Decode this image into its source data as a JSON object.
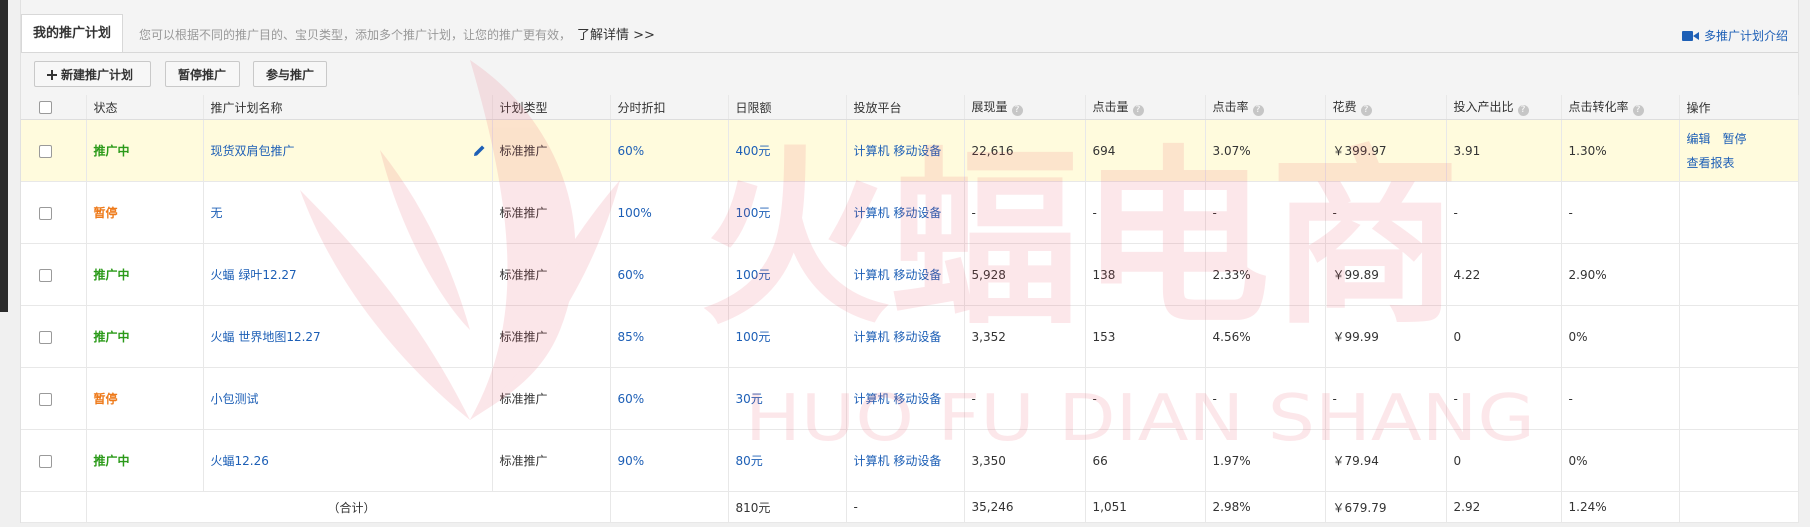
{
  "tab": {
    "label": "我的推广计划"
  },
  "tip": {
    "text": "您可以根据不同的推广目的、宝贝类型，添加多个推广计划，让您的推广更有效，",
    "more": "了解详情 >>"
  },
  "intro_link": {
    "label": "多推广计划介绍",
    "icon": "video-camera-icon"
  },
  "toolbar": {
    "new_label": "新建推广计划",
    "pause_label": "暂停推广",
    "join_label": "参与推广"
  },
  "columns": [
    "状态",
    "推广计划名称",
    "计划类型",
    "分时折扣",
    "日限额",
    "投放平台",
    "展现量",
    "点击量",
    "点击率",
    "花费",
    "投入产出比",
    "点击转化率",
    "操作"
  ],
  "rows": [
    {
      "status": "推广中",
      "status_type": "on",
      "name": "现货双肩包推广",
      "type": "标准推广",
      "discount": "60%",
      "budget": "400元",
      "platform": "计算机 移动设备",
      "impressions": "22,616",
      "clicks": "694",
      "ctr": "3.07%",
      "cost": "￥399.97",
      "roi": "3.91",
      "cvr": "1.30%",
      "highlight": true,
      "ops": [
        "编辑",
        "暂停",
        "查看报表"
      ]
    },
    {
      "status": "暂停",
      "status_type": "pause",
      "name": "无",
      "type": "标准推广",
      "discount": "100%",
      "budget": "100元",
      "platform": "计算机 移动设备",
      "impressions": "-",
      "clicks": "-",
      "ctr": "-",
      "cost": "-",
      "roi": "-",
      "cvr": "-"
    },
    {
      "status": "推广中",
      "status_type": "on",
      "name": "火蝠 绿叶12.27",
      "type": "标准推广",
      "discount": "60%",
      "budget": "100元",
      "platform": "计算机 移动设备",
      "impressions": "5,928",
      "clicks": "138",
      "ctr": "2.33%",
      "cost": "￥99.89",
      "roi": "4.22",
      "cvr": "2.90%"
    },
    {
      "status": "推广中",
      "status_type": "on",
      "name": "火蝠 世界地图12.27",
      "type": "标准推广",
      "discount": "85%",
      "budget": "100元",
      "platform": "计算机 移动设备",
      "impressions": "3,352",
      "clicks": "153",
      "ctr": "4.56%",
      "cost": "￥99.99",
      "roi": "0",
      "cvr": "0%"
    },
    {
      "status": "暂停",
      "status_type": "pause",
      "name": "小包测试",
      "type": "标准推广",
      "discount": "60%",
      "budget": "30元",
      "platform": "计算机 移动设备",
      "impressions": "-",
      "clicks": "-",
      "ctr": "-",
      "cost": "-",
      "roi": "-",
      "cvr": "-"
    },
    {
      "status": "推广中",
      "status_type": "on",
      "name": "火蝠12.26",
      "type": "标准推广",
      "discount": "90%",
      "budget": "80元",
      "platform": "计算机 移动设备",
      "impressions": "3,350",
      "clicks": "66",
      "ctr": "1.97%",
      "cost": "￥79.94",
      "roi": "0",
      "cvr": "0%"
    }
  ],
  "total": {
    "label": "（合计）",
    "budget": "810元",
    "platform": "-",
    "impressions": "35,246",
    "clicks": "1,051",
    "ctr": "2.98%",
    "cost": "￥679.79",
    "roi": "2.92",
    "cvr": "1.24%"
  },
  "watermark": {
    "text": "火蝠电商",
    "subtext": "HUO FU DIAN SHANG"
  },
  "colors": {
    "link": "#1d5fb6",
    "status_on": "#2b9a19",
    "status_pause": "#ee7a1a",
    "highlight": "#fffbdd",
    "watermark": "#e8435a"
  }
}
